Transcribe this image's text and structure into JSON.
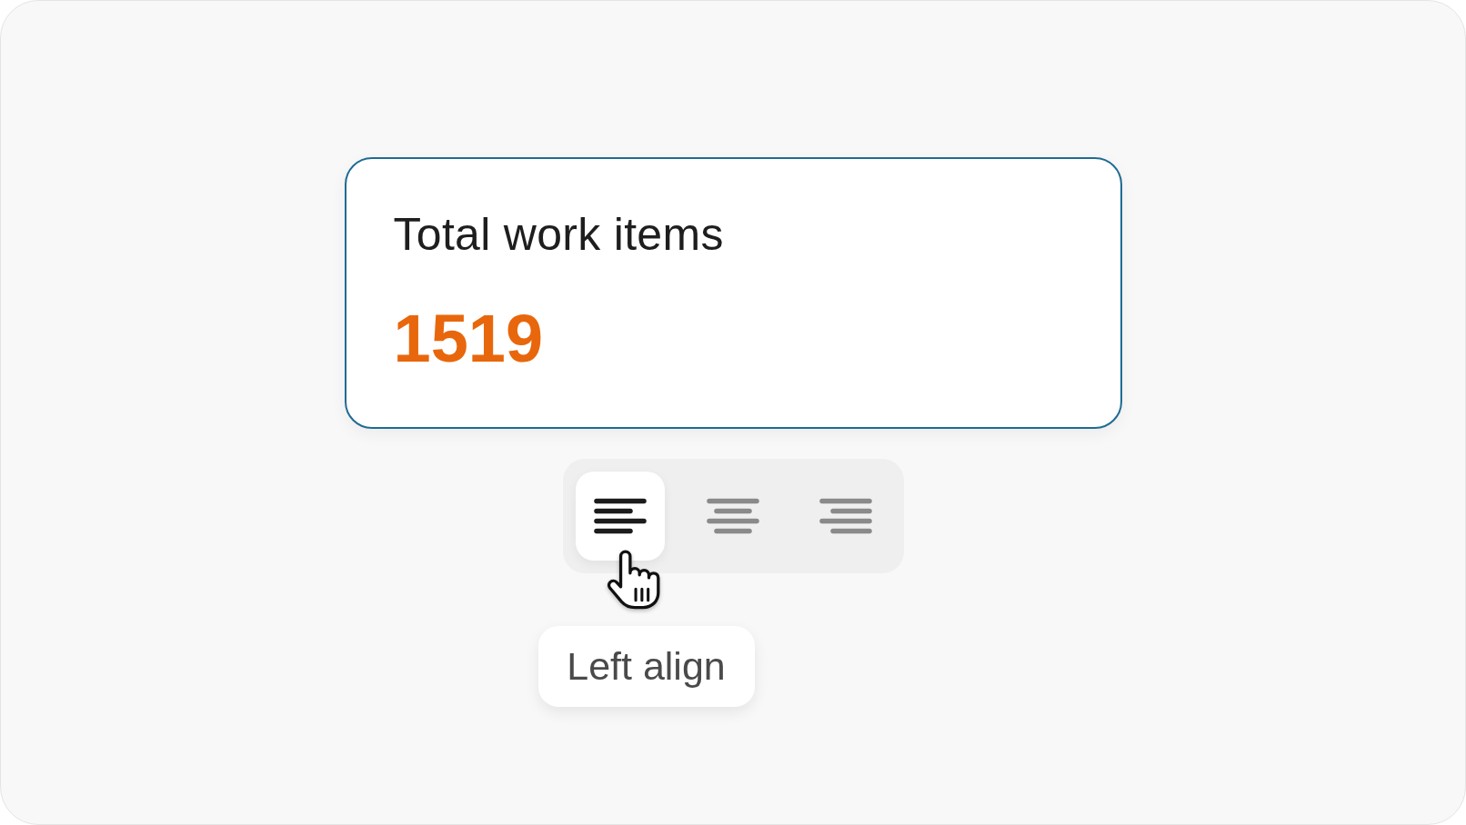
{
  "card": {
    "title": "Total work items",
    "value": "1519"
  },
  "alignment_buttons": [
    {
      "kind": "left",
      "selected": true
    },
    {
      "kind": "center",
      "selected": false
    },
    {
      "kind": "right",
      "selected": false
    }
  ],
  "tooltip": {
    "text": "Left align"
  }
}
